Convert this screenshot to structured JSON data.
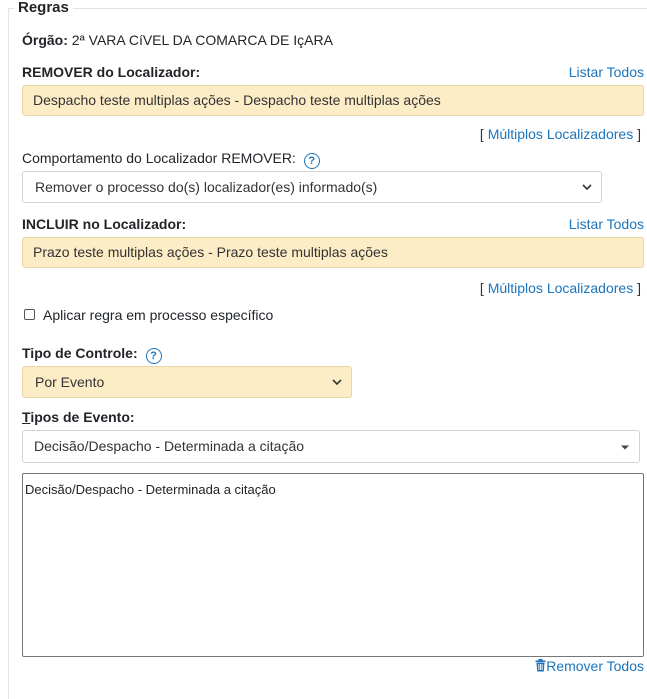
{
  "legend": "Regras",
  "orgao": {
    "label": "Órgão:",
    "value": "2ª VARA CíVEL DA COMARCA DE IçARA"
  },
  "remover": {
    "label": "REMOVER do Localizador:",
    "listar_todos": "Listar Todos",
    "value": "Despacho teste multiplas ações - Despacho teste multiplas ações",
    "multi_open": "[",
    "multi_link": "Múltiplos Localizadores",
    "multi_close": "]"
  },
  "comportamento": {
    "label": "Comportamento do Localizador REMOVER:",
    "help": "?",
    "selected": "Remover o processo do(s) localizador(es) informado(s)"
  },
  "incluir": {
    "label": "INCLUIR no Localizador:",
    "listar_todos": "Listar Todos",
    "value": "Prazo teste multiplas ações - Prazo teste multiplas ações",
    "multi_open": "[",
    "multi_link": "Múltiplos Localizadores",
    "multi_close": "]"
  },
  "aplicar_regra": {
    "label": "Aplicar regra em processo específico",
    "checked": false
  },
  "tipo_controle": {
    "label": "Tipo de Controle:",
    "help": "?",
    "selected": "Por Evento"
  },
  "tipos_evento": {
    "label_first": "T",
    "label_rest": "ipos de Evento:",
    "selected": "Decisão/Despacho - Determinada a citação",
    "textarea": "Decisão/Despacho - Determinada a citação"
  },
  "remover_todos": "Remover Todos",
  "colors": {
    "link": "#1c75bc",
    "highlight": "#fdedc7"
  }
}
